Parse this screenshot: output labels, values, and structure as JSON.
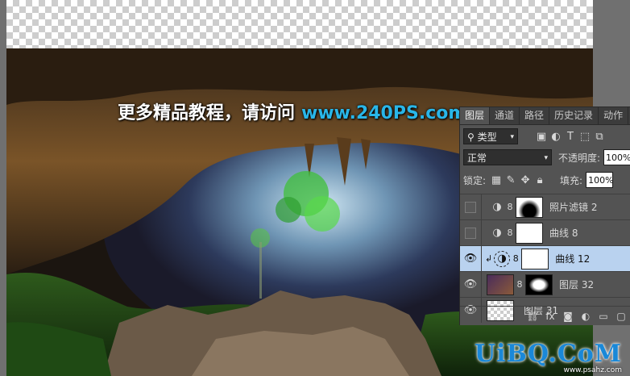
{
  "watermark": {
    "text": "更多精品教程，请访问",
    "site": "www.240PS.com"
  },
  "logo": {
    "text": "UiBQ.CoM",
    "sub": "www.psahz.com"
  },
  "panel": {
    "tabs": [
      "图层",
      "通道",
      "路径",
      "历史记录",
      "动作"
    ],
    "filter_kind": "类型",
    "blend_mode": "正常",
    "opacity_label": "不透明度:",
    "opacity_value": "100%",
    "lock_label": "锁定:",
    "fill_label": "填充:",
    "fill_value": "100%",
    "layers": [
      {
        "name": "照片滤镜 2",
        "visible": false,
        "selected": false
      },
      {
        "name": "曲线 8",
        "visible": false,
        "selected": false
      },
      {
        "name": "曲线 12",
        "visible": true,
        "selected": true
      },
      {
        "name": "图层 32",
        "visible": true,
        "selected": false
      },
      {
        "name": "图层 31",
        "visible": true,
        "selected": false
      }
    ]
  },
  "colors": {
    "panel_bg": "#535353",
    "selected_row": "#b9d2ef",
    "watermark_site": "#29b6e8",
    "logo": "#1a88d8"
  }
}
